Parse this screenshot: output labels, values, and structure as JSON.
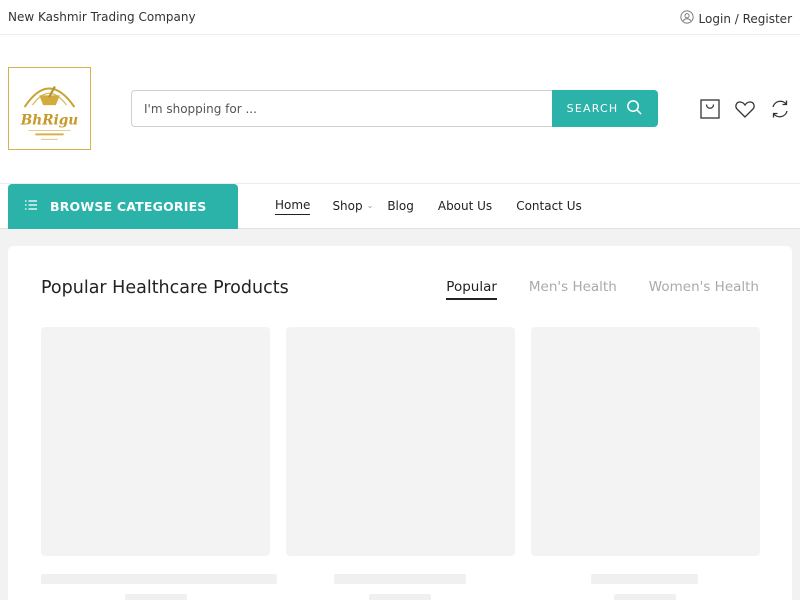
{
  "topbar": {
    "company": "New Kashmir Trading Company",
    "login": "Login / Register",
    "user_icon": "user-icon"
  },
  "header": {
    "logo_text": "BhRigu",
    "search": {
      "placeholder": "I'm shopping for ...",
      "button_label": "SEARCH"
    },
    "icons": [
      "cart-icon",
      "heart-icon",
      "refresh-icon"
    ]
  },
  "navbar": {
    "browse_label": "BROWSE CATEGORIES",
    "items": [
      {
        "label": "Home"
      },
      {
        "label": "Shop"
      },
      {
        "label": "Blog"
      },
      {
        "label": "About Us"
      },
      {
        "label": "Contact Us"
      }
    ]
  },
  "section": {
    "title": "Popular Healthcare Products",
    "tabs": [
      {
        "label": "Popular"
      },
      {
        "label": "Men's Health"
      },
      {
        "label": "Women's Health"
      }
    ]
  },
  "colors": {
    "accent": "#2bb3aa",
    "gold": "#d6b24a"
  }
}
